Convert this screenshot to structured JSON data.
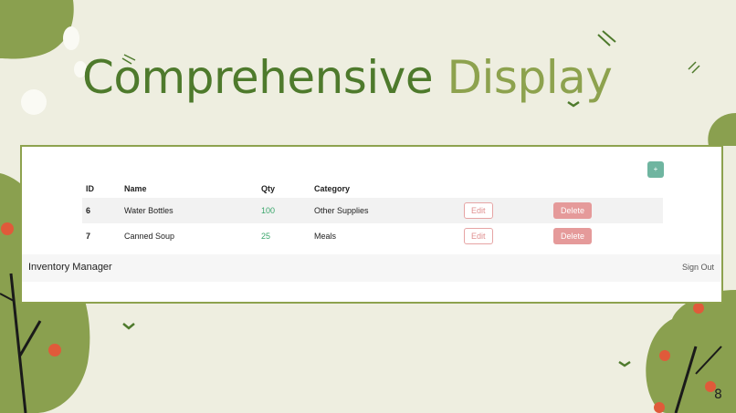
{
  "slide": {
    "title_word1": "Comprehensive",
    "title_word2": "Display",
    "page_number": "8"
  },
  "app": {
    "add_button_label": "+",
    "columns": [
      "ID",
      "Name",
      "Qty",
      "Category"
    ],
    "rows": [
      {
        "id": "6",
        "name": "Water Bottles",
        "qty": "100",
        "category": "Other Supplies",
        "edit": "Edit",
        "delete": "Delete"
      },
      {
        "id": "7",
        "name": "Canned Soup",
        "qty": "25",
        "category": "Meals",
        "edit": "Edit",
        "delete": "Delete"
      }
    ],
    "footer": {
      "brand": "Inventory Manager",
      "sign_out": "Sign Out"
    }
  },
  "colors": {
    "title_dark_green": "#4e7a2c",
    "title_light_green": "#8da24e",
    "qty_green": "#3aa66b",
    "delete_pink": "#e59a9a",
    "add_teal": "#6fb5a0",
    "background": "#eeeee0"
  }
}
